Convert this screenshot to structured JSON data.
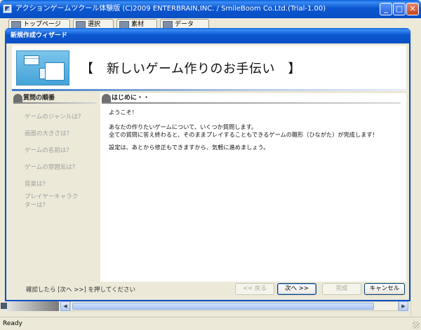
{
  "window": {
    "title": "アクションゲームツクール体験版 (C)2009 ENTERBRAIN,INC. / SmileBoom Co.Ltd.(Trial-1.00)",
    "minimize_glyph": "_",
    "maximize_glyph": "□",
    "close_glyph": "✕"
  },
  "main_tabs": [
    {
      "label": "トップページ"
    },
    {
      "label": "選択"
    },
    {
      "label": "素材"
    },
    {
      "label": "データ"
    }
  ],
  "status_bar": {
    "text": "Ready"
  },
  "dialog": {
    "title": "新規作成ウィザード",
    "header_title": "【　新しいゲーム作りのお手伝い　】",
    "left_section_title": "質問の順番",
    "right_section_title": "はじめに・・",
    "questions": [
      "ゲームのジャンルは?",
      "画面の大きさは?",
      "ゲームの名前は?",
      "ゲームの雰囲気は?",
      "音楽は?",
      "プレイヤーキャラク",
      "ターは?"
    ],
    "content_lines": [
      "ようこそ！",
      "あなたの作りたいゲームについて、いくつか質問します。",
      "全ての質問に答え終わると、そのままプレイすることもできるゲームの雛形（ひながた）が完成します！",
      "設定は、あとから修正もできますから、気軽に進めましょう。"
    ],
    "footer_hint": "確認したら [次へ >>] を押してください",
    "buttons": {
      "back": "<< 戻る",
      "next": "次へ >>",
      "finish": "完成",
      "cancel": "キャンセル"
    }
  },
  "colors": {
    "titlebar_blue": "#0a4fc4",
    "dialog_bg": "#ece9d8",
    "disabled_text": "#9e9e9e"
  }
}
